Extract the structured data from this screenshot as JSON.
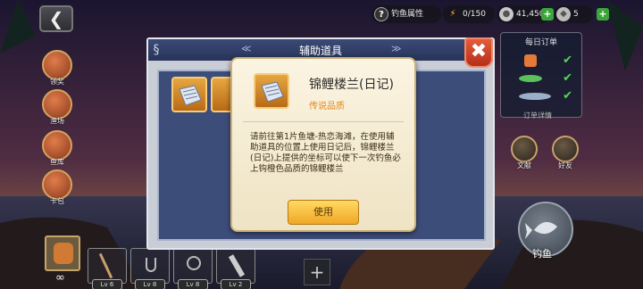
{
  "hud": {
    "fishing_attr_label": "钓鱼属性",
    "energy": "0/150",
    "coins": "41,450",
    "gems": "5"
  },
  "side_menu": [
    {
      "label": "领奖"
    },
    {
      "label": "渔场"
    },
    {
      "label": "鱼库"
    },
    {
      "label": "卡包"
    }
  ],
  "daily_orders": {
    "title": "每日订单",
    "detail_label": "订单详情"
  },
  "right_buttons": {
    "book_label": "文献",
    "friends_label": "好友",
    "fish_label": "钓鱼"
  },
  "bottom_bar": {
    "infinity": "∞",
    "levels": [
      "Lv 6",
      "Lv 8",
      "Lv 8",
      "Lv 2"
    ],
    "add": "+"
  },
  "dialog": {
    "title": "辅助道具",
    "close": "✖"
  },
  "tooltip": {
    "item_name": "锦鲤楼兰(日记)",
    "quality": "传说品质",
    "description": "请前往第1片鱼塘-热恋海滩，在使用辅助道具的位置上使用日记后，锦鲤楼兰(日记)上提供的坐标可以使下一次钓鱼必上钩橙色品质的锦鲤楼兰",
    "use_button": "使用"
  },
  "colors": {
    "dialog_header": "#3b4a77",
    "dialog_body": "#3d4d7a",
    "item_orange": "#e7a640",
    "quality_orange": "#e08a1c",
    "use_button": "#ffd964",
    "close_red": "#e55b3b"
  }
}
